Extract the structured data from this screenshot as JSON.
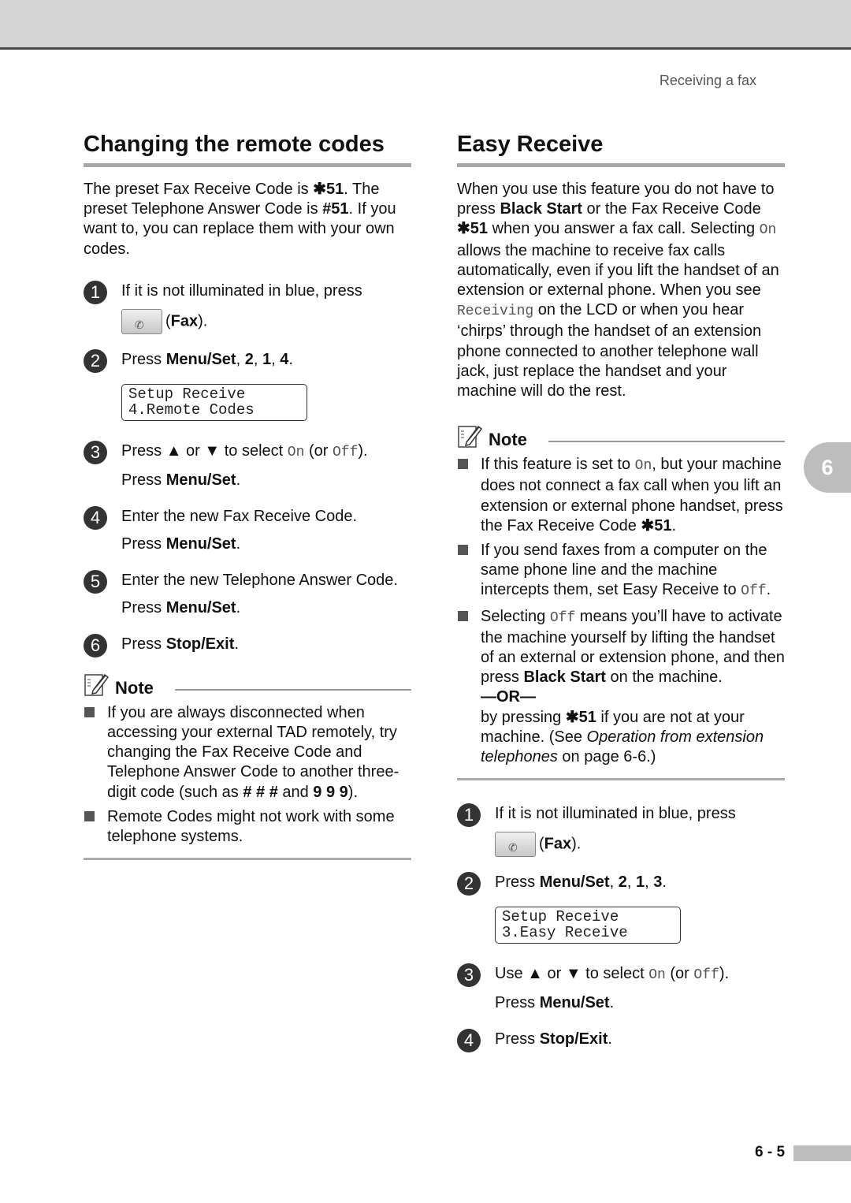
{
  "running_head": "Receiving a fax",
  "chapter_tab": "6",
  "page_number": "6 - 5",
  "glyphs": {
    "star": "∗",
    "up": "▲",
    "down": "▼",
    "fax_icon": "fax-button-icon"
  },
  "left": {
    "title": "Changing the remote codes",
    "intro": {
      "t1": "The preset Fax Receive Code is ",
      "code1": "✱51",
      "t2": ". The preset Telephone Answer Code is ",
      "code2": "#51",
      "t3": ". If you want to, you can replace them with your own codes."
    },
    "steps": [
      {
        "num": "1",
        "text": "If it is not illuminated in blue, press",
        "sub_b": "Fax",
        "sub_pre": "(",
        "sub_post": ")."
      },
      {
        "num": "2",
        "pre": "Press ",
        "menu": "Menu/Set",
        "sep1": ", ",
        "k1": "2",
        "sep2": ", ",
        "k2": "1",
        "sep3": ", ",
        "k3": "4",
        "end": ".",
        "lcd": [
          "Setup Receive",
          "4.Remote Codes"
        ]
      },
      {
        "num": "3",
        "pre": "Press ",
        "up": "▲",
        "mid": " or ",
        "down": "▼",
        "post": " to select ",
        "on": "On",
        "or": " (or ",
        "off": "Off",
        "close": ").",
        "sub_pre": "Press ",
        "sub_b": "Menu/Set",
        "sub_post": "."
      },
      {
        "num": "4",
        "text": "Enter the new Fax Receive Code.",
        "sub_pre": "Press ",
        "sub_b": "Menu/Set",
        "sub_post": "."
      },
      {
        "num": "5",
        "text": "Enter the new Telephone Answer Code.",
        "sub_pre": "Press ",
        "sub_b": "Menu/Set",
        "sub_post": "."
      },
      {
        "num": "6",
        "pre": "Press ",
        "b": "Stop/Exit",
        "post": "."
      }
    ],
    "note": {
      "label": "Note",
      "items": [
        {
          "t1": "If you are always disconnected when accessing your external TAD remotely, try changing the Fax Receive Code and Telephone Answer Code to another three-digit code (such as ",
          "b1": "# # #",
          "t2": " and ",
          "b2": "9 9 9",
          "t3": ")."
        },
        {
          "t1": "Remote Codes might not work with some telephone systems."
        }
      ]
    }
  },
  "right": {
    "title": "Easy Receive",
    "intro": {
      "t1": "When you use this feature you do not have to press ",
      "b1": "Black Start",
      "t2": " or the Fax Receive Code ",
      "b2": "✱51",
      "t3": " when you answer a fax call. Selecting ",
      "m1": "On",
      "t4": " allows the machine to receive fax calls automatically, even if you lift the handset of an extension or external phone. When you see ",
      "m2": "Receiving",
      "t5": " on the LCD or when you hear ‘chirps’ through the handset of an extension phone connected to another telephone wall jack, just replace the handset and your machine will do the rest."
    },
    "note": {
      "label": "Note",
      "items": [
        {
          "t1": "If this feature is set to ",
          "m1": "On",
          "t2": ", but your machine does not connect a fax call when you lift an extension or external phone handset, press the Fax Receive Code ",
          "b1": "✱51",
          "t3": "."
        },
        {
          "t1": "If you send faxes from a computer on the same phone line and the machine intercepts them, set Easy Receive to ",
          "m1": "Off",
          "t2": "."
        },
        {
          "t1": "Selecting ",
          "m1": "Off",
          "t2": " means you’ll have to activate the machine yourself by lifting the handset of an external or extension phone, and then press ",
          "b1": "Black Start",
          "t3": " on the machine.",
          "or": "—OR—",
          "t4": "by pressing ",
          "b2": "✱51",
          "t5": " if you are not at your machine. (See ",
          "i1": "Operation from extension telephones",
          "t6": " on page 6-6.)"
        }
      ]
    },
    "steps": [
      {
        "num": "1",
        "text": "If it is not illuminated in blue, press",
        "sub_pre": "(",
        "sub_b": "Fax",
        "sub_post": ")."
      },
      {
        "num": "2",
        "pre": "Press ",
        "menu": "Menu/Set",
        "sep1": ", ",
        "k1": "2",
        "sep2": ", ",
        "k2": "1",
        "sep3": ", ",
        "k3": "3",
        "end": ".",
        "lcd": [
          "Setup Receive",
          "3.Easy Receive"
        ]
      },
      {
        "num": "3",
        "pre": "Use ",
        "up": "▲",
        "mid": " or ",
        "down": "▼",
        "post": " to select ",
        "on": "On",
        "or": " (or ",
        "off": "Off",
        "close": ").",
        "sub_pre": "Press ",
        "sub_b": "Menu/Set",
        "sub_post": "."
      },
      {
        "num": "4",
        "pre": "Press ",
        "b": "Stop/Exit",
        "post": "."
      }
    ]
  }
}
